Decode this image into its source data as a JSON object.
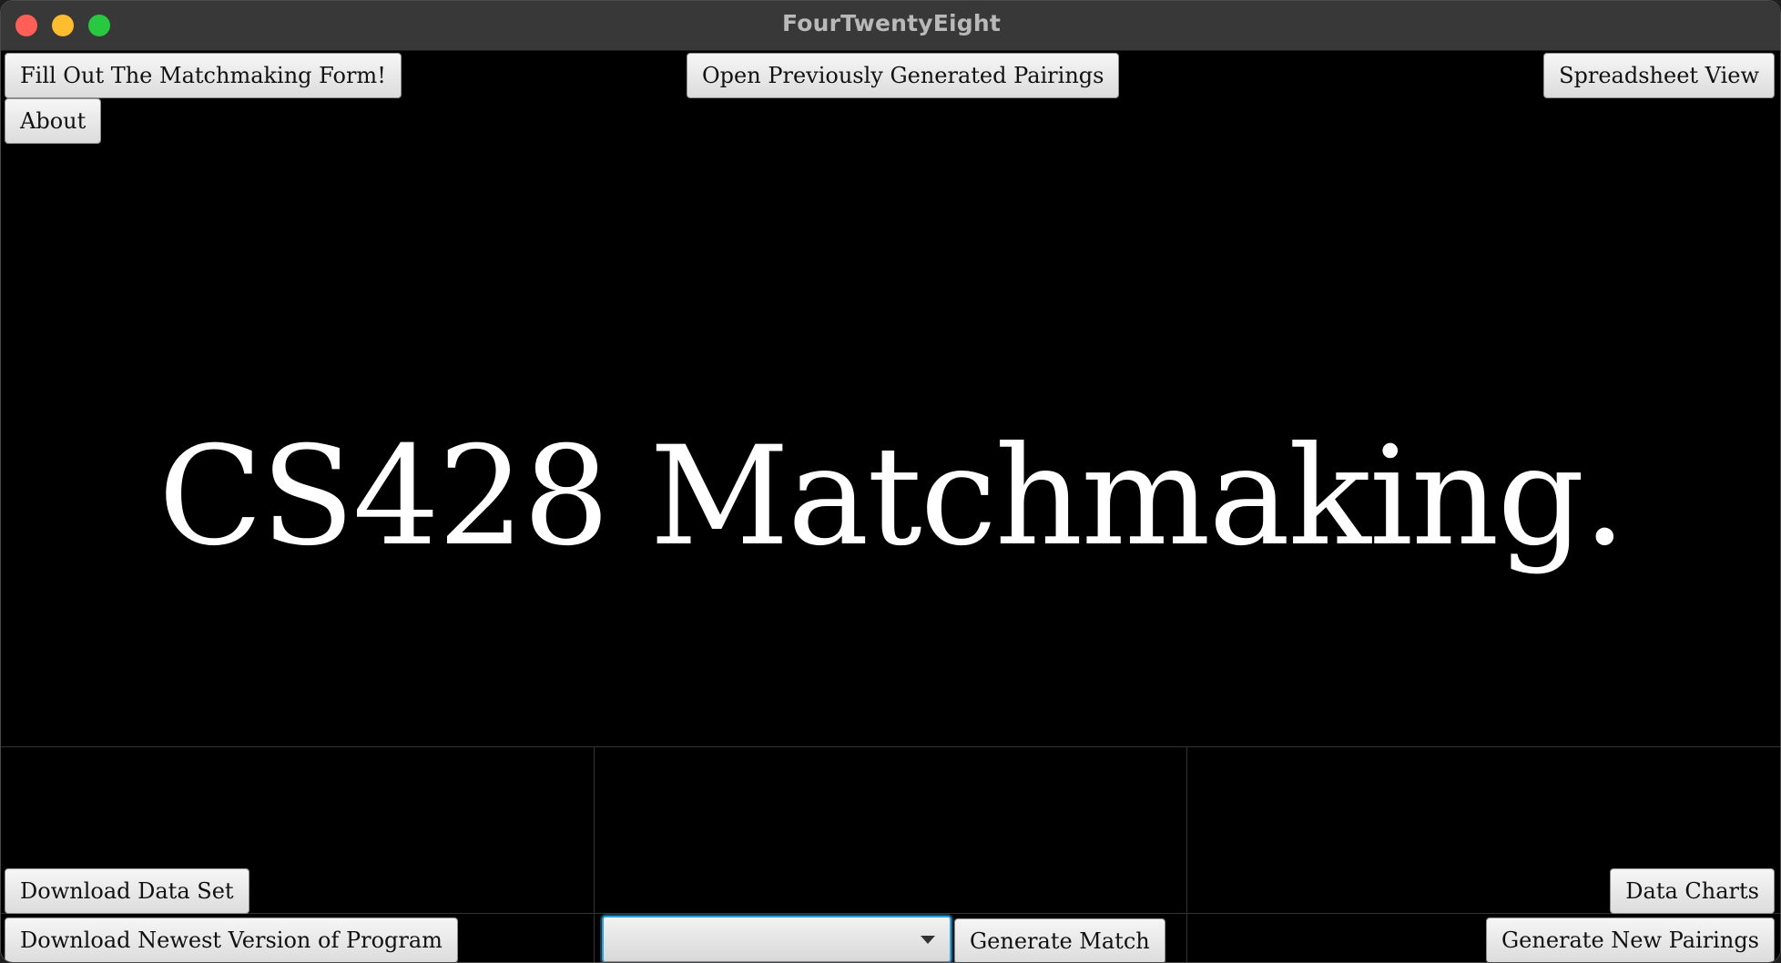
{
  "window": {
    "title": "FourTwentyEight"
  },
  "top_buttons": {
    "fill_form": "Fill Out The Matchmaking Form!",
    "open_pairings": "Open Previously Generated Pairings",
    "spreadsheet": "Spreadsheet View",
    "about": "About"
  },
  "hero": {
    "title": "CS428 Matchmaking."
  },
  "bottom_buttons": {
    "download_data": "Download Data Set",
    "data_charts": "Data Charts",
    "download_program": "Download Newest Version of Program",
    "generate_match": "Generate Match",
    "generate_pairings": "Generate New Pairings"
  },
  "match_select": {
    "value": "",
    "icon": "chevron-down-icon"
  },
  "colors": {
    "background": "#000000",
    "titlebar": "#383838",
    "title_text": "#b9b9b9",
    "hero_text": "#ffffff",
    "button_bg": "#e6e6e6",
    "focus_ring": "#2f9fd8",
    "close": "#ff5f57",
    "minimize": "#febc2e",
    "maximize": "#28c840"
  }
}
